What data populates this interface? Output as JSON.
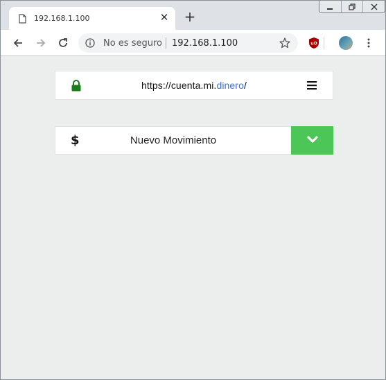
{
  "browser": {
    "tab": {
      "title": "192.168.1.100",
      "favicon": "document-icon",
      "close_icon": "close-icon"
    },
    "new_tab_icon": "plus-icon",
    "window_controls": [
      "minimize-icon",
      "restore-icon",
      "close-icon"
    ],
    "toolbar": {
      "back_icon": "arrow-left-icon",
      "forward_icon": "arrow-right-icon",
      "reload_icon": "reload-icon",
      "omnibox": {
        "security_icon": "info-icon",
        "security_text": "No es seguro",
        "url": "192.168.1.100",
        "bookmark_icon": "star-icon"
      },
      "extension_icon": "ublock-shield-icon",
      "profile_icon": "avatar",
      "menu_icon": "kebab-menu-icon"
    }
  },
  "page": {
    "header": {
      "lock_icon": "lock-icon",
      "url_prefix": "https://cuenta.mi.",
      "url_accent": "dinero",
      "url_suffix": "/",
      "menu_icon": "hamburger-icon"
    },
    "movement": {
      "icon": "dollar-icon",
      "icon_glyph": "$",
      "label": "Nuevo Movimiento",
      "expand_icon": "chevron-down-icon"
    }
  },
  "colors": {
    "page_bg": "#eceeee",
    "accent_green": "#4cc757",
    "lock_green": "#1a7f1a",
    "url_accent": "#3b6fd6",
    "ublock_red": "#a80000"
  }
}
